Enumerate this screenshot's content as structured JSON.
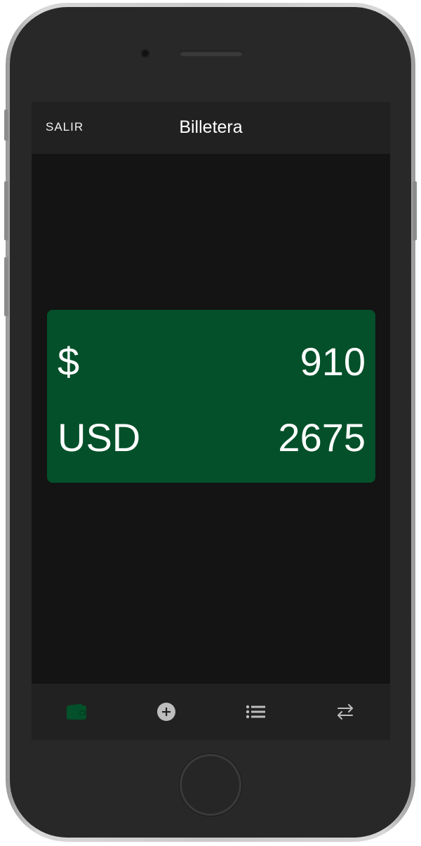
{
  "app_bar": {
    "exit_label": "SALIR",
    "title": "Billetera"
  },
  "balances": [
    {
      "currency": "$",
      "amount": "910"
    },
    {
      "currency": "USD",
      "amount": "2675"
    }
  ],
  "bottom_nav": {
    "items": [
      {
        "icon": "wallet-icon",
        "active": true
      },
      {
        "icon": "add-circle-icon",
        "active": false
      },
      {
        "icon": "list-icon",
        "active": false
      },
      {
        "icon": "swap-arrows-icon",
        "active": false
      }
    ]
  },
  "colors": {
    "accent": "#03502a",
    "background": "#141414",
    "bar": "#212121",
    "inactive_icon": "#bdbdbd"
  }
}
